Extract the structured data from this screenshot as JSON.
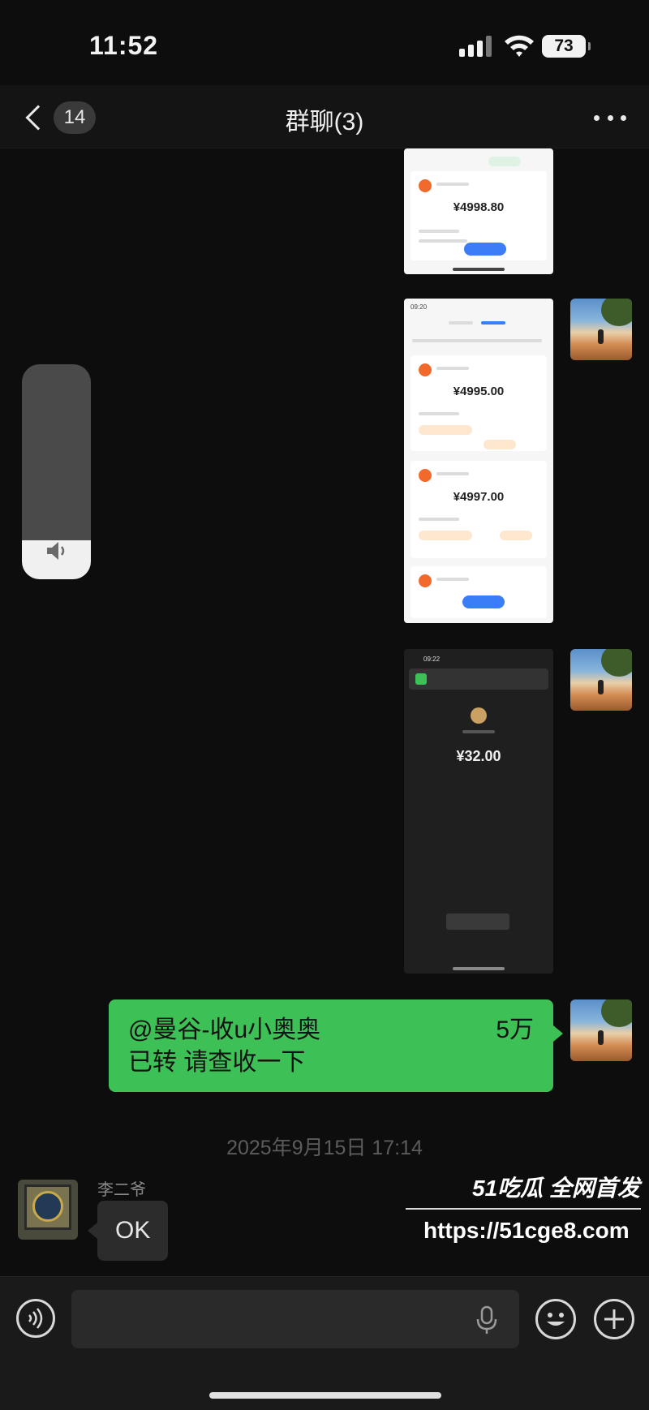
{
  "status_bar": {
    "time": "11:52",
    "battery": "73"
  },
  "nav": {
    "unread_count": "14",
    "title": "群聊(3)"
  },
  "shots": {
    "shot1": {
      "amount": "¥4998.80"
    },
    "shot2": {
      "time": "09:20",
      "amount1": "¥4995.00",
      "amount2": "¥4997.00"
    },
    "shot3": {
      "time": "09:22",
      "amount": "¥32.00"
    }
  },
  "messages": {
    "self_text_line1": "@曼谷-收u小奥奥",
    "self_text_suffix": "5万",
    "self_text_line2": "已转 请查收一下",
    "timestamp": "2025年9月15日 17:14",
    "sender_name": "李二爷",
    "other_text": "OK"
  },
  "watermark": {
    "brand": "51吃瓜 全网首发",
    "url": "https://51cge8.com"
  },
  "colors": {
    "bubble_green": "#3dc056",
    "background": "#0d0d0d"
  }
}
